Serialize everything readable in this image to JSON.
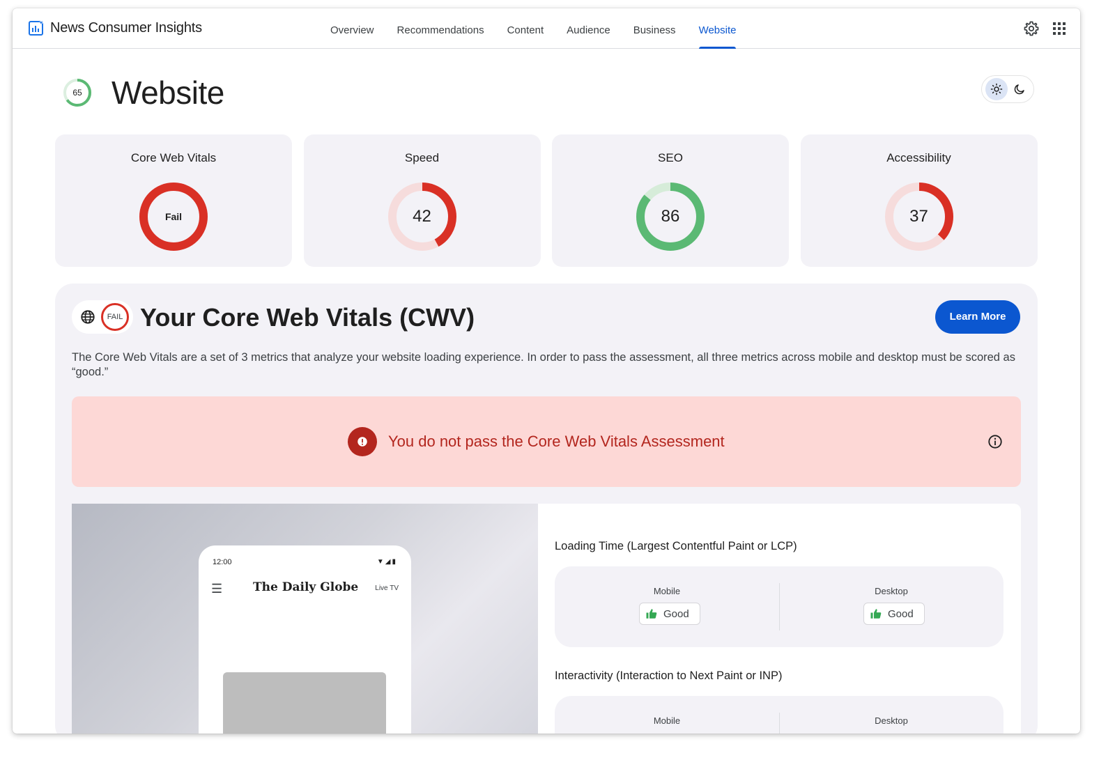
{
  "app": {
    "name": "News Consumer Insights"
  },
  "nav": {
    "items": [
      "Overview",
      "Recommendations",
      "Content",
      "Audience",
      "Business",
      "Website"
    ],
    "active": "Website"
  },
  "header": {
    "title": "Website",
    "overall_score": "65",
    "overall_score_fraction": 0.65
  },
  "colors": {
    "accent": "#0b57d0",
    "fail": "#d93025",
    "pass": "#5bb974",
    "alert_bg": "#fdd8d6",
    "alert_text": "#b3261e"
  },
  "cards": [
    {
      "title": "Core Web Vitals",
      "value": "Fail",
      "fraction": 1.0,
      "status": "fail"
    },
    {
      "title": "Speed",
      "value": "42",
      "fraction": 0.42,
      "status": "fail"
    },
    {
      "title": "SEO",
      "value": "86",
      "fraction": 0.86,
      "status": "pass"
    },
    {
      "title": "Accessibility",
      "value": "37",
      "fraction": 0.37,
      "status": "fail"
    }
  ],
  "cwv": {
    "badge": "FAIL",
    "title": "Your Core Web Vitals (CWV)",
    "learn_more": "Learn More",
    "description": "The Core Web Vitals are a set of 3 metrics that analyze your website loading experience. In order to pass the assessment, all three metrics across mobile and desktop must be scored as “good.”",
    "alert": "You do not pass the Core Web Vitals Assessment"
  },
  "preview": {
    "time": "12:00",
    "site_name": "The Daily Globe",
    "live": "Live TV"
  },
  "metrics": [
    {
      "label": "Loading Time (Largest Contentful Paint or LCP)",
      "mobile_label": "Mobile",
      "mobile_value": "Good",
      "desktop_label": "Desktop",
      "desktop_value": "Good"
    },
    {
      "label": "Interactivity (Interaction to Next Paint or INP)",
      "mobile_label": "Mobile",
      "desktop_label": "Desktop"
    }
  ]
}
